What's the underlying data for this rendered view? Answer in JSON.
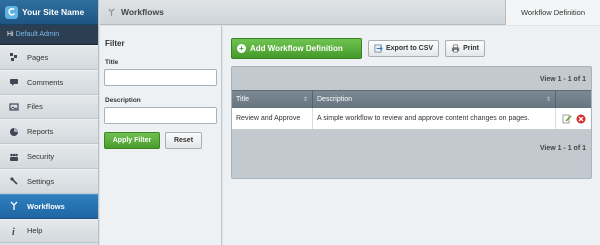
{
  "site": {
    "name": "Your Site Name",
    "greeting": "Hi",
    "user": "Default Admin"
  },
  "sidebar": {
    "items": [
      {
        "label": "Pages",
        "icon": "pages-icon",
        "active": false
      },
      {
        "label": "Comments",
        "icon": "comments-icon",
        "active": false
      },
      {
        "label": "Files",
        "icon": "files-icon",
        "active": false
      },
      {
        "label": "Reports",
        "icon": "reports-icon",
        "active": false
      },
      {
        "label": "Security",
        "icon": "security-icon",
        "active": false
      },
      {
        "label": "Settings",
        "icon": "settings-icon",
        "active": false
      },
      {
        "label": "Workflows",
        "icon": "workflows-icon",
        "active": true
      },
      {
        "label": "Help",
        "icon": "help-icon",
        "active": false
      }
    ]
  },
  "header": {
    "title": "Workflows",
    "tab": "Workflow Definition"
  },
  "filter": {
    "heading": "Filter",
    "title_label": "Title",
    "title_value": "",
    "description_label": "Description",
    "description_value": "",
    "apply_label": "Apply Filter",
    "reset_label": "Reset"
  },
  "toolbar": {
    "add_label": "Add Workflow Definition",
    "export_label": "Export to CSV",
    "print_label": "Print"
  },
  "grid": {
    "pager_top": "View 1 - 1 of 1",
    "pager_bottom": "View 1 - 1 of 1",
    "columns": [
      "Title",
      "Description"
    ],
    "rows": [
      {
        "title": "Review and Approve",
        "description": "A simple workflow to review and approve content changes on pages."
      }
    ]
  },
  "colors": {
    "accent_blue": "#1f66a3",
    "button_green": "#4a9d2d",
    "delete_red": "#d42a2a"
  }
}
